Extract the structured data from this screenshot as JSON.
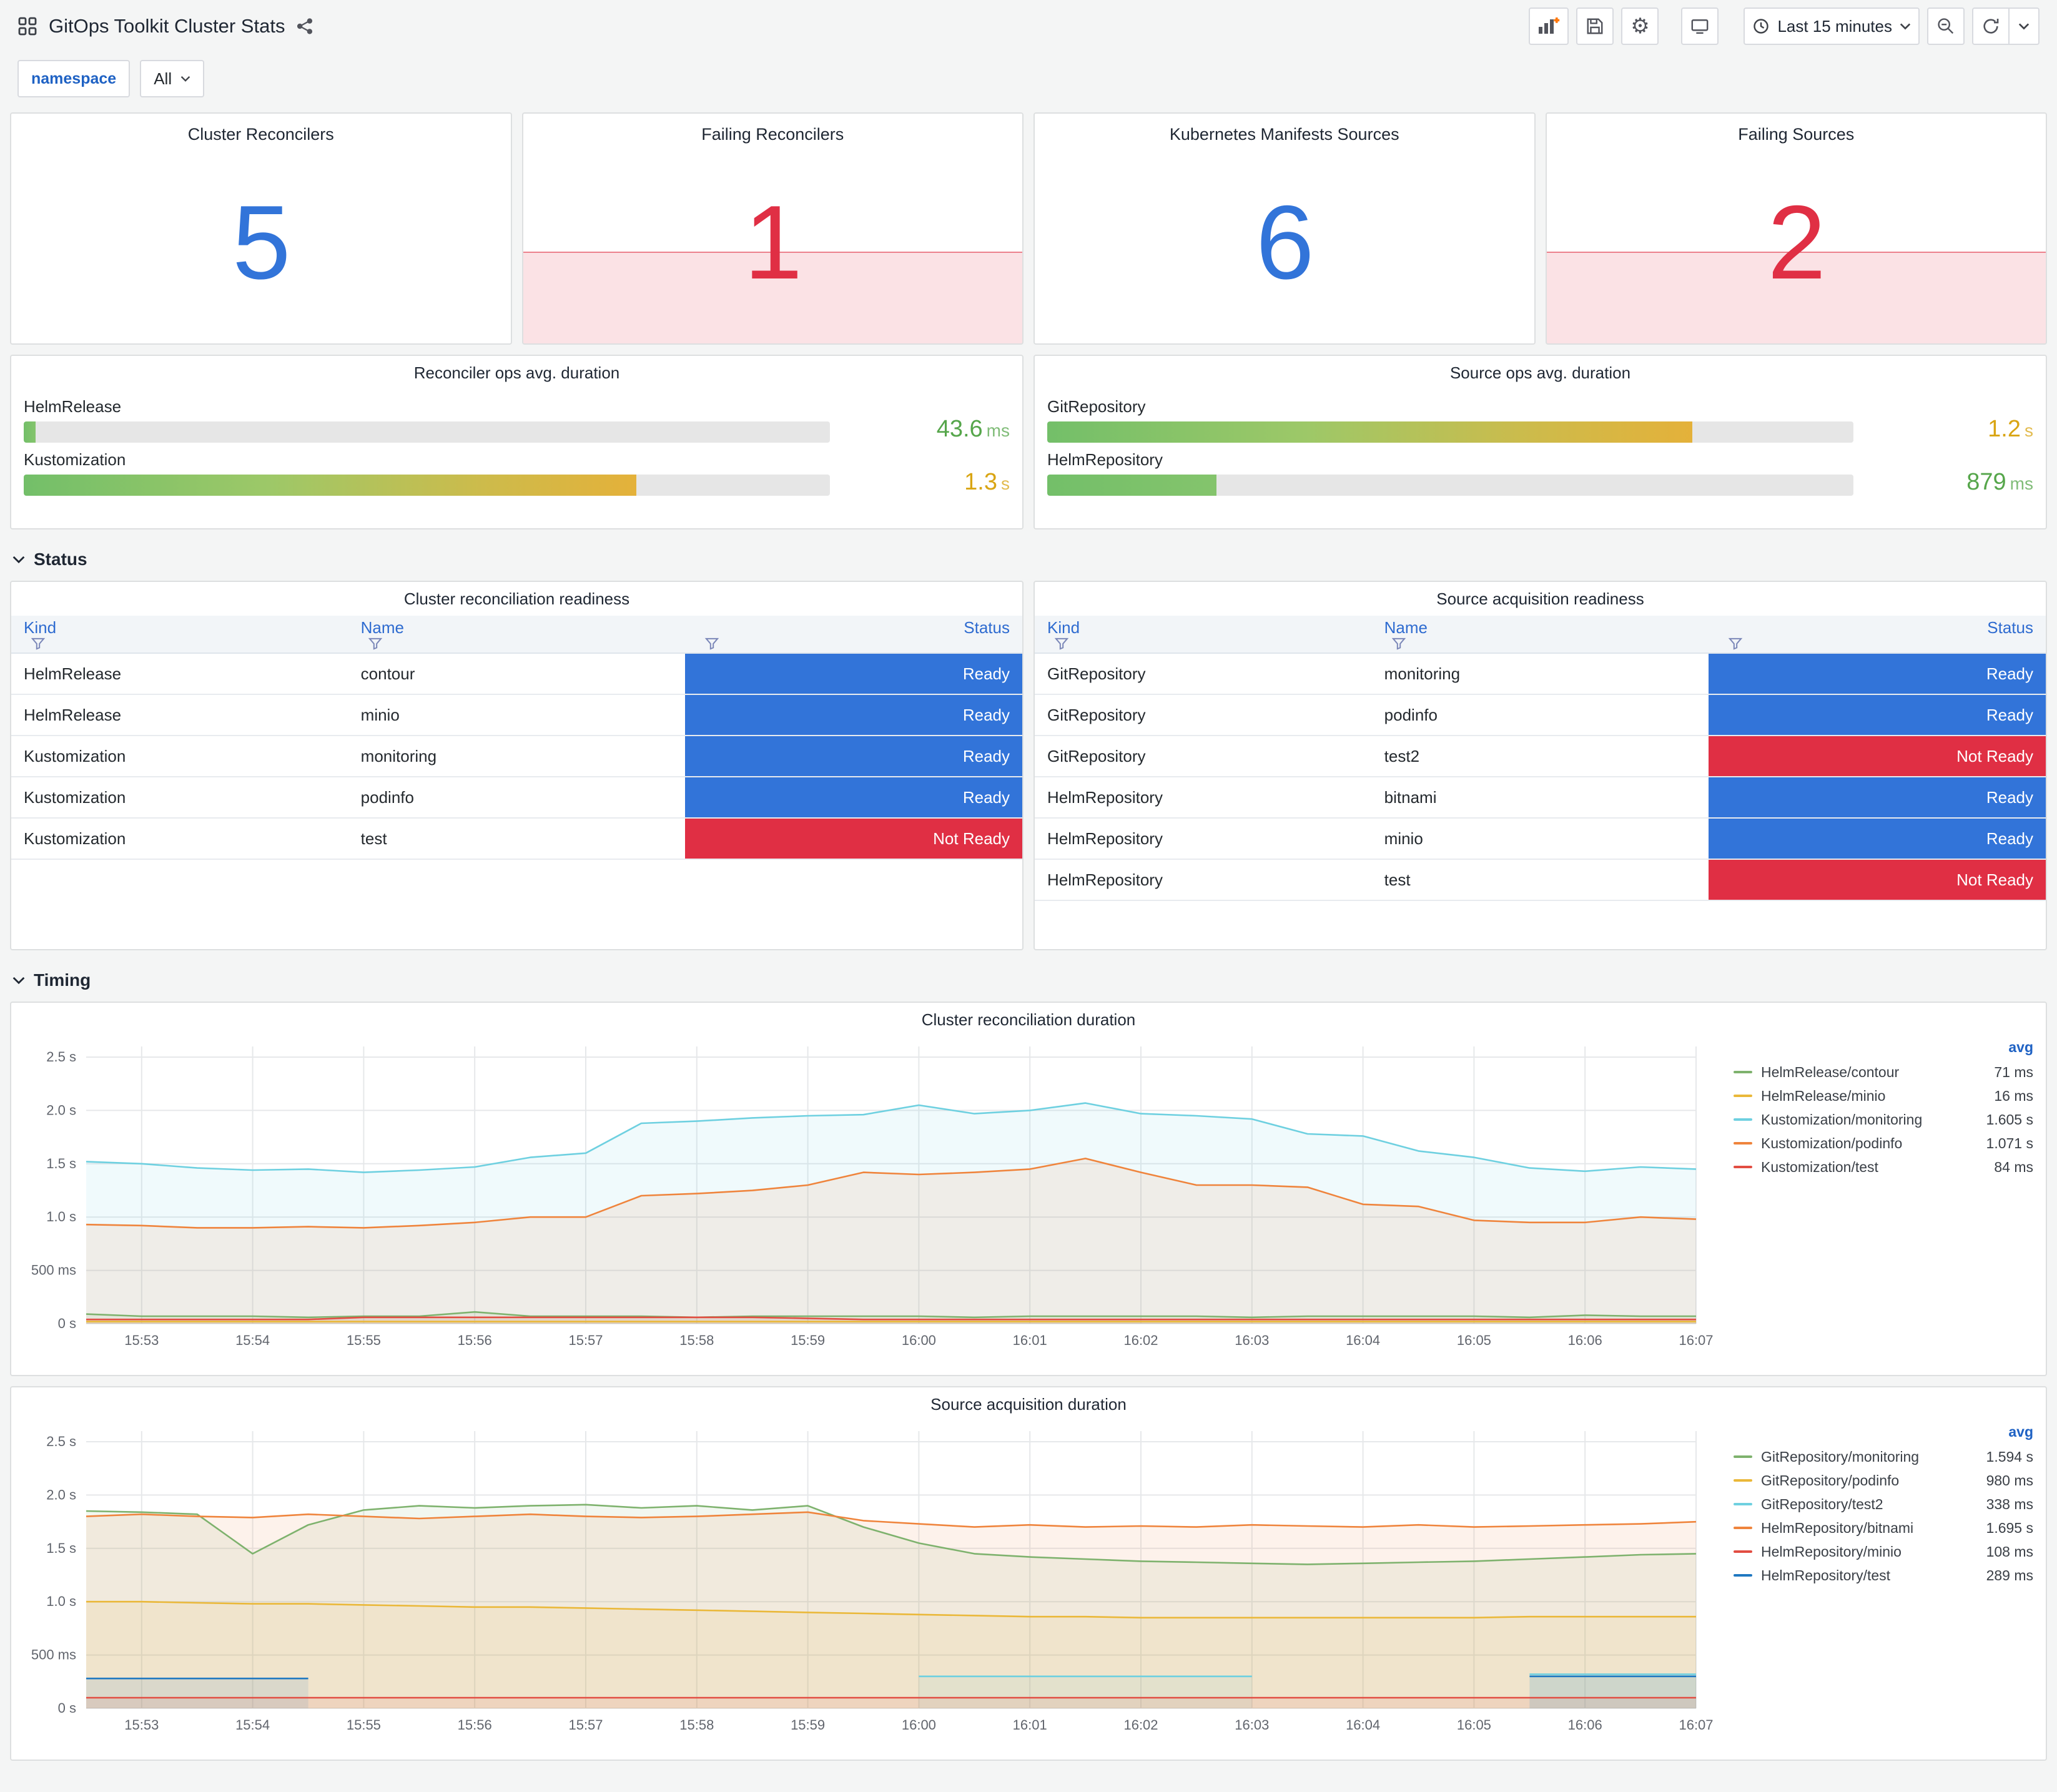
{
  "header": {
    "title": "GitOps Toolkit Cluster Stats",
    "time_range": "Last 15 minutes"
  },
  "variables": {
    "label": "namespace",
    "value": "All"
  },
  "colors": {
    "blue": "#3274D9",
    "red": "#E02F44",
    "green": "#56A64B",
    "amber": "#D9A514"
  },
  "sections": {
    "status": "Status",
    "timing": "Timing"
  },
  "stats": [
    {
      "title": "Cluster Reconcilers",
      "value": "5",
      "state": "ok"
    },
    {
      "title": "Failing Reconcilers",
      "value": "1",
      "state": "alert"
    },
    {
      "title": "Kubernetes Manifests Sources",
      "value": "6",
      "state": "ok"
    },
    {
      "title": "Failing Sources",
      "value": "2",
      "state": "alert"
    }
  ],
  "gauges": [
    {
      "title": "Reconciler ops avg. duration",
      "rows": [
        {
          "label": "HelmRelease",
          "value": "43.6",
          "unit": "ms",
          "pct": 1.5,
          "tone": "green",
          "value_color": "#56A64B"
        },
        {
          "label": "Kustomization",
          "value": "1.3",
          "unit": "s",
          "pct": 76,
          "tone": "gradient",
          "value_color": "#D9A514"
        }
      ]
    },
    {
      "title": "Source ops avg. duration",
      "rows": [
        {
          "label": "GitRepository",
          "value": "1.2",
          "unit": "s",
          "pct": 80,
          "tone": "gradient",
          "value_color": "#D9A514"
        },
        {
          "label": "HelmRepository",
          "value": "879",
          "unit": "ms",
          "pct": 21,
          "tone": "green",
          "value_color": "#56A64B"
        }
      ]
    }
  ],
  "tables": [
    {
      "title": "Cluster reconciliation readiness",
      "columns": [
        "Kind",
        "Name",
        "Status"
      ],
      "rows": [
        {
          "kind": "HelmRelease",
          "name": "contour",
          "status": "Ready"
        },
        {
          "kind": "HelmRelease",
          "name": "minio",
          "status": "Ready"
        },
        {
          "kind": "Kustomization",
          "name": "monitoring",
          "status": "Ready"
        },
        {
          "kind": "Kustomization",
          "name": "podinfo",
          "status": "Ready"
        },
        {
          "kind": "Kustomization",
          "name": "test",
          "status": "Not Ready"
        }
      ]
    },
    {
      "title": "Source acquisition readiness",
      "columns": [
        "Kind",
        "Name",
        "Status"
      ],
      "rows": [
        {
          "kind": "GitRepository",
          "name": "monitoring",
          "status": "Ready"
        },
        {
          "kind": "GitRepository",
          "name": "podinfo",
          "status": "Ready"
        },
        {
          "kind": "GitRepository",
          "name": "test2",
          "status": "Not Ready"
        },
        {
          "kind": "HelmRepository",
          "name": "bitnami",
          "status": "Ready"
        },
        {
          "kind": "HelmRepository",
          "name": "minio",
          "status": "Ready"
        },
        {
          "kind": "HelmRepository",
          "name": "test",
          "status": "Not Ready"
        }
      ]
    }
  ],
  "chart_data": [
    {
      "type": "line",
      "title": "Cluster reconciliation duration",
      "legend_header": "avg",
      "ylim": [
        0,
        2.6
      ],
      "y_ticks": [
        {
          "v": 0,
          "label": "0 s"
        },
        {
          "v": 0.5,
          "label": "500 ms"
        },
        {
          "v": 1,
          "label": "1.0 s"
        },
        {
          "v": 1.5,
          "label": "1.5 s"
        },
        {
          "v": 2,
          "label": "2.0 s"
        },
        {
          "v": 2.5,
          "label": "2.5 s"
        }
      ],
      "x_ticks": [
        "15:53",
        "15:54",
        "15:55",
        "15:56",
        "15:57",
        "15:58",
        "15:59",
        "16:00",
        "16:01",
        "16:02",
        "16:03",
        "16:04",
        "16:05",
        "16:06",
        "16:07"
      ],
      "series": [
        {
          "name": "HelmRelease/contour",
          "avg": "71 ms",
          "color": "#7EB26D",
          "values": [
            0.09,
            0.07,
            0.07,
            0.07,
            0.06,
            0.07,
            0.07,
            0.11,
            0.07,
            0.07,
            0.07,
            0.06,
            0.07,
            0.07,
            0.07,
            0.07,
            0.06,
            0.07,
            0.07,
            0.07,
            0.07,
            0.06,
            0.07,
            0.07,
            0.07,
            0.07,
            0.06,
            0.08,
            0.07,
            0.07
          ]
        },
        {
          "name": "HelmRelease/minio",
          "avg": "16 ms",
          "color": "#EAB839",
          "values": [
            0.02,
            0.02,
            0.02,
            0.02,
            0.02,
            0.02,
            0.02,
            0.02,
            0.02,
            0.02,
            0.02,
            0.02,
            0.02,
            0.02,
            0.02,
            0.02,
            0.02,
            0.02,
            0.02,
            0.02,
            0.02,
            0.02,
            0.02,
            0.02,
            0.02,
            0.02,
            0.02,
            0.02,
            0.02,
            0.02
          ]
        },
        {
          "name": "Kustomization/monitoring",
          "avg": "1.605 s",
          "color": "#6ED0E0",
          "values": [
            1.52,
            1.5,
            1.46,
            1.44,
            1.45,
            1.42,
            1.44,
            1.47,
            1.56,
            1.6,
            1.88,
            1.9,
            1.93,
            1.95,
            1.96,
            2.05,
            1.97,
            2.0,
            2.07,
            1.97,
            1.95,
            1.92,
            1.78,
            1.76,
            1.62,
            1.56,
            1.46,
            1.43,
            1.47,
            1.45
          ]
        },
        {
          "name": "Kustomization/podinfo",
          "avg": "1.071 s",
          "color": "#EF843C",
          "values": [
            0.93,
            0.92,
            0.9,
            0.9,
            0.91,
            0.9,
            0.92,
            0.95,
            1.0,
            1.0,
            1.2,
            1.22,
            1.25,
            1.3,
            1.42,
            1.4,
            1.42,
            1.45,
            1.55,
            1.42,
            1.3,
            1.3,
            1.28,
            1.12,
            1.1,
            0.97,
            0.95,
            0.95,
            1.0,
            0.98
          ]
        },
        {
          "name": "Kustomization/test",
          "avg": "84 ms",
          "color": "#E24D42",
          "values": [
            0.04,
            0.04,
            0.04,
            0.04,
            0.04,
            0.06,
            0.06,
            0.06,
            0.06,
            0.06,
            0.06,
            0.06,
            0.06,
            0.05,
            0.04,
            0.04,
            0.04,
            0.04,
            0.04,
            0.04,
            0.04,
            0.04,
            0.04,
            0.04,
            0.04,
            0.04,
            0.04,
            0.04,
            0.04,
            0.04
          ]
        }
      ]
    },
    {
      "type": "line",
      "title": "Source acquisition duration",
      "legend_header": "avg",
      "ylim": [
        0,
        2.6
      ],
      "y_ticks": [
        {
          "v": 0,
          "label": "0 s"
        },
        {
          "v": 0.5,
          "label": "500 ms"
        },
        {
          "v": 1,
          "label": "1.0 s"
        },
        {
          "v": 1.5,
          "label": "1.5 s"
        },
        {
          "v": 2,
          "label": "2.0 s"
        },
        {
          "v": 2.5,
          "label": "2.5 s"
        }
      ],
      "x_ticks": [
        "15:53",
        "15:54",
        "15:55",
        "15:56",
        "15:57",
        "15:58",
        "15:59",
        "16:00",
        "16:01",
        "16:02",
        "16:03",
        "16:04",
        "16:05",
        "16:06",
        "16:07"
      ],
      "series": [
        {
          "name": "GitRepository/monitoring",
          "avg": "1.594 s",
          "color": "#7EB26D",
          "values": [
            1.85,
            1.84,
            1.82,
            1.45,
            1.72,
            1.86,
            1.9,
            1.88,
            1.9,
            1.91,
            1.88,
            1.9,
            1.86,
            1.9,
            1.7,
            1.55,
            1.45,
            1.42,
            1.4,
            1.38,
            1.37,
            1.36,
            1.35,
            1.36,
            1.37,
            1.38,
            1.4,
            1.42,
            1.44,
            1.45
          ]
        },
        {
          "name": "GitRepository/podinfo",
          "avg": "980 ms",
          "color": "#EAB839",
          "values": [
            1.0,
            1.0,
            0.99,
            0.98,
            0.98,
            0.97,
            0.96,
            0.95,
            0.95,
            0.94,
            0.93,
            0.92,
            0.91,
            0.9,
            0.89,
            0.88,
            0.87,
            0.86,
            0.86,
            0.85,
            0.85,
            0.85,
            0.85,
            0.85,
            0.85,
            0.85,
            0.86,
            0.86,
            0.86,
            0.86
          ]
        },
        {
          "name": "GitRepository/test2",
          "avg": "338 ms",
          "color": "#6ED0E0",
          "values": [
            null,
            null,
            null,
            null,
            null,
            null,
            null,
            null,
            null,
            null,
            null,
            null,
            null,
            null,
            null,
            0.3,
            0.3,
            0.3,
            0.3,
            0.3,
            0.3,
            0.3,
            null,
            null,
            null,
            null,
            0.32,
            0.32,
            0.32,
            0.32
          ]
        },
        {
          "name": "HelmRepository/bitnami",
          "avg": "1.695 s",
          "color": "#EF843C",
          "values": [
            1.8,
            1.82,
            1.8,
            1.79,
            1.82,
            1.8,
            1.78,
            1.8,
            1.82,
            1.8,
            1.79,
            1.8,
            1.82,
            1.84,
            1.76,
            1.73,
            1.7,
            1.72,
            1.7,
            1.71,
            1.7,
            1.72,
            1.71,
            1.7,
            1.72,
            1.7,
            1.71,
            1.72,
            1.73,
            1.75
          ]
        },
        {
          "name": "HelmRepository/minio",
          "avg": "108 ms",
          "color": "#E24D42",
          "values": [
            0.1,
            0.1,
            0.1,
            0.1,
            0.1,
            0.1,
            0.1,
            0.1,
            0.1,
            0.1,
            0.1,
            0.1,
            0.1,
            0.1,
            0.1,
            0.1,
            0.1,
            0.1,
            0.1,
            0.1,
            0.1,
            0.1,
            0.1,
            0.1,
            0.1,
            0.1,
            0.1,
            0.1,
            0.1,
            0.1
          ]
        },
        {
          "name": "HelmRepository/test",
          "avg": "289 ms",
          "color": "#1F78C1",
          "values": [
            0.28,
            0.28,
            0.28,
            0.28,
            0.28,
            null,
            null,
            null,
            null,
            null,
            null,
            null,
            null,
            null,
            null,
            null,
            null,
            null,
            null,
            null,
            null,
            null,
            null,
            null,
            null,
            null,
            0.3,
            0.3,
            0.3,
            0.3
          ]
        }
      ]
    }
  ]
}
